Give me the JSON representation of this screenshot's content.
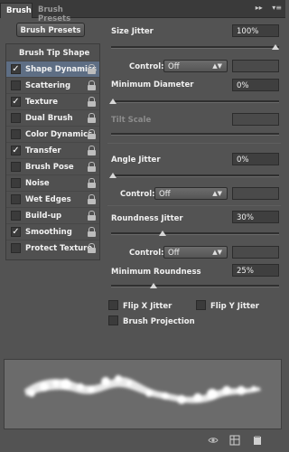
{
  "tabs": {
    "brush": "Brush",
    "presets": "Brush Presets"
  },
  "panel_menu": {
    "collapse": "▸▸",
    "menu": "▾≡"
  },
  "brush_presets_button": "Brush Presets",
  "list": {
    "header": "Brush Tip Shape",
    "items": [
      {
        "label": "Shape Dynamics",
        "checked": "✓",
        "selected": true
      },
      {
        "label": "Scattering",
        "checked": ""
      },
      {
        "label": "Texture",
        "checked": "✓"
      },
      {
        "label": "Dual Brush",
        "checked": ""
      },
      {
        "label": "Color Dynamics",
        "checked": ""
      },
      {
        "label": "Transfer",
        "checked": "✓"
      },
      {
        "label": "Brush Pose",
        "checked": ""
      },
      {
        "label": "Noise",
        "checked": ""
      },
      {
        "label": "Wet Edges",
        "checked": ""
      },
      {
        "label": "Build-up",
        "checked": ""
      },
      {
        "label": "Smoothing",
        "checked": "✓"
      },
      {
        "label": "Protect Texture",
        "checked": ""
      }
    ]
  },
  "size_jitter": {
    "label": "Size Jitter",
    "value": "100%",
    "control_label": "Control:",
    "control_value": "Off"
  },
  "minimum_diameter": {
    "label": "Minimum Diameter",
    "value": "0%"
  },
  "tilt_scale": {
    "label": "Tilt Scale"
  },
  "angle_jitter": {
    "label": "Angle Jitter",
    "value": "0%",
    "control_label": "Control:",
    "control_value": "Off"
  },
  "roundness_jitter": {
    "label": "Roundness Jitter",
    "value": "30%",
    "control_label": "Control:",
    "control_value": "Off"
  },
  "minimum_roundness": {
    "label": "Minimum Roundness",
    "value": "25%"
  },
  "flip_x": {
    "label": "Flip X Jitter"
  },
  "flip_y": {
    "label": "Flip Y Jitter"
  },
  "brush_projection": {
    "label": "Brush Projection"
  },
  "icons": [
    "eye-brush-icon",
    "grid-icon",
    "new-preset-icon"
  ],
  "colors": {
    "panel": "#535353",
    "selected_row": "#5e6e84",
    "tab_bar": "#3a3a3a"
  }
}
